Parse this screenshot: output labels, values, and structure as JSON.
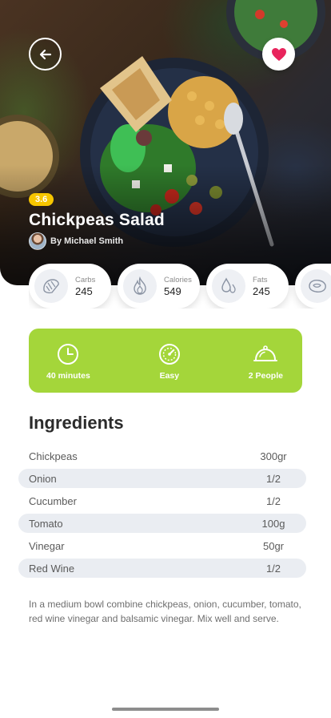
{
  "colors": {
    "accent_green": "#a4d63a",
    "rating_yellow": "#f7c600",
    "heart_pink": "#e8245c",
    "row_alt": "#eaedf2"
  },
  "hero": {
    "back_icon": "arrow-left-icon",
    "favorite_icon": "heart-icon",
    "rating": "3.6",
    "title": "Chickpeas Salad",
    "author": "By Michael Smith"
  },
  "nutrition": [
    {
      "label": "Carbs",
      "value": "245",
      "icon": "croissant-icon"
    },
    {
      "label": "Calories",
      "value": "549",
      "icon": "flame-icon"
    },
    {
      "label": "Fats",
      "value": "245",
      "icon": "drops-icon"
    },
    {
      "label": "",
      "value": "",
      "icon": "steak-icon"
    }
  ],
  "info": [
    {
      "label": "40 minutes",
      "icon": "clock-icon"
    },
    {
      "label": "Easy",
      "icon": "gauge-icon"
    },
    {
      "label": "2 People",
      "icon": "cloche-icon"
    }
  ],
  "ingredients": {
    "title": "Ingredients",
    "items": [
      {
        "name": "Chickpeas",
        "amount": "300gr"
      },
      {
        "name": "Onion",
        "amount": "1/2"
      },
      {
        "name": "Cucumber",
        "amount": "1/2"
      },
      {
        "name": "Tomato",
        "amount": "100g"
      },
      {
        "name": "Vinegar",
        "amount": "50gr"
      },
      {
        "name": "Red Wine",
        "amount": "1/2"
      }
    ]
  },
  "description": "In a medium bowl combine chickpeas, onion, cucumber, tomato, red wine vinegar and balsamic vinegar. Mix well and serve."
}
